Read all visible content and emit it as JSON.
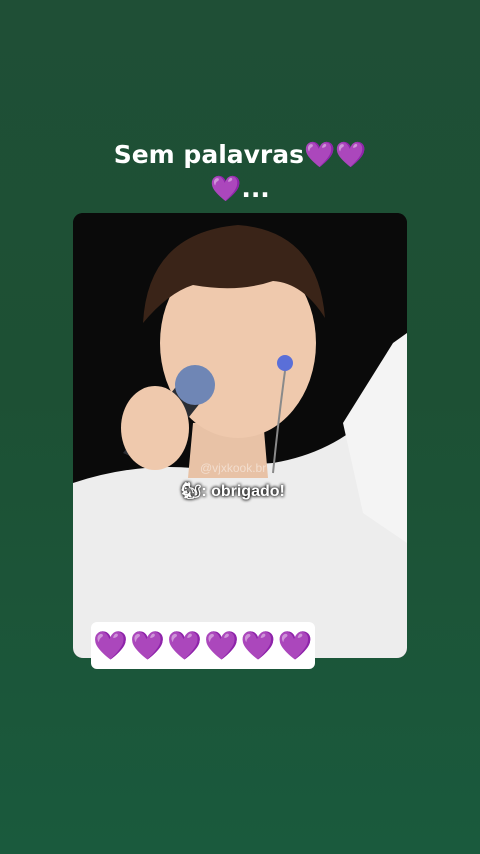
{
  "caption": {
    "line1": "Sem palavras💜💜",
    "line2": "💜..."
  },
  "video": {
    "watermark": "@vjxkook.br",
    "subtitle": "🐿: obrigado!"
  },
  "hearts_bar": [
    "💜",
    "💜",
    "💜",
    "💜",
    "💜",
    "💜"
  ],
  "colors": {
    "background": "#1d5034",
    "heart": "#8a2be2"
  }
}
